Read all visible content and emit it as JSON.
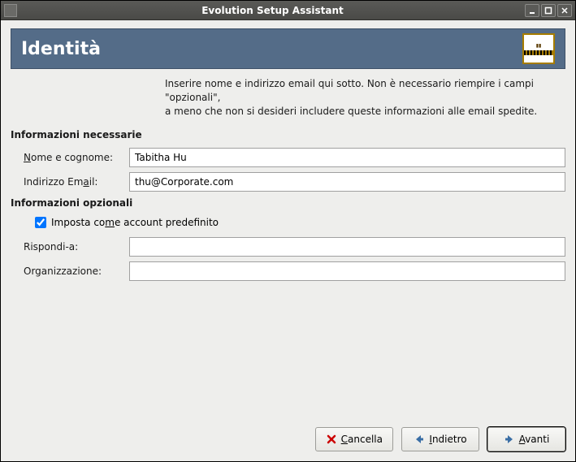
{
  "window": {
    "title": "Evolution Setup Assistant"
  },
  "header": {
    "page_title": "Identità"
  },
  "intro": {
    "line1": "Inserire nome e indirizzo email qui sotto. Non è necessario riempire i campi \"opzionali\",",
    "line2": "a meno che non si desideri includere queste informazioni alle email spedite."
  },
  "sections": {
    "required": "Informazioni necessarie",
    "optional": "Informazioni opzionali"
  },
  "labels": {
    "fullname_pre": "N",
    "fullname_post": "ome e cognome:",
    "email_pre": "Indirizzo Em",
    "email_ul": "a",
    "email_post": "il:",
    "default_account_pre": "Imposta co",
    "default_account_ul": "m",
    "default_account_post": "e account predefinito",
    "replyto": "Rispondi-a:",
    "organization": "Organizzazione:"
  },
  "fields": {
    "fullname": "Tabitha Hu",
    "email": "thu@Corporate.com",
    "default_account_checked": true,
    "replyto": "",
    "organization": ""
  },
  "buttons": {
    "cancel_ul": "C",
    "cancel_post": "ancella",
    "back_ul": "I",
    "back_post": "ndietro",
    "forward_ul": "A",
    "forward_post": "vanti"
  }
}
